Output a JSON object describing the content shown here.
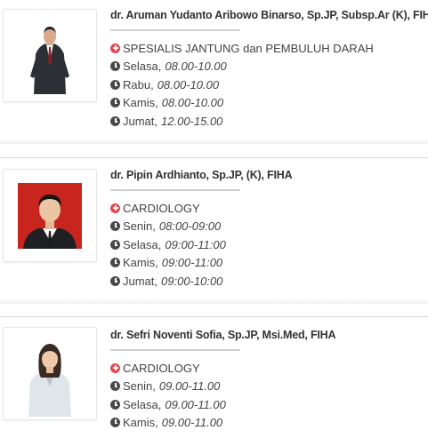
{
  "doctors": [
    {
      "name": "dr. Aruman Yudanto Aribowo Binarso, Sp.JP, Subsp.Ar (K), FIHA",
      "specialty": "SPESIALIS JANTUNG dan PEMBULUH DARAH",
      "photo_background": "#ffffff",
      "schedule": [
        {
          "day": "Selasa,",
          "time": "08.00-10.00"
        },
        {
          "day": "Rabu,",
          "time": "08.00-10.00"
        },
        {
          "day": "Kamis,",
          "time": "08.00-10.00"
        },
        {
          "day": "Jumat,",
          "time": "12.00-15.00"
        }
      ]
    },
    {
      "name": "dr. Pipin Ardhianto, Sp.JP, (K), FIHA",
      "specialty": "CARDIOLOGY",
      "photo_background": "#c8251e",
      "schedule": [
        {
          "day": "Senin,",
          "time": "08:00-09:00"
        },
        {
          "day": "Selasa,",
          "time": "09:00-11:00"
        },
        {
          "day": "Kamis,",
          "time": "09:00-11:00"
        },
        {
          "day": "Jumat,",
          "time": "09:00-10:00"
        }
      ]
    },
    {
      "name": "dr. Sefri Noventi Sofia, Sp.JP, Msi.Med, FIHA",
      "specialty": "CARDIOLOGY",
      "photo_background": "#ffffff",
      "schedule": [
        {
          "day": "Senin,",
          "time": "09.00-11.00"
        },
        {
          "day": "Selasa,",
          "time": "09.00-11.00"
        },
        {
          "day": "Kamis,",
          "time": "09.00-11.00"
        }
      ]
    }
  ],
  "colors": {
    "specialty_icon": "#e2474f",
    "clock_icon": "#4a4a4a",
    "divider": "#cfcfcf"
  },
  "icons": {
    "specialty": "plus-circle-icon",
    "schedule": "clock-icon"
  }
}
